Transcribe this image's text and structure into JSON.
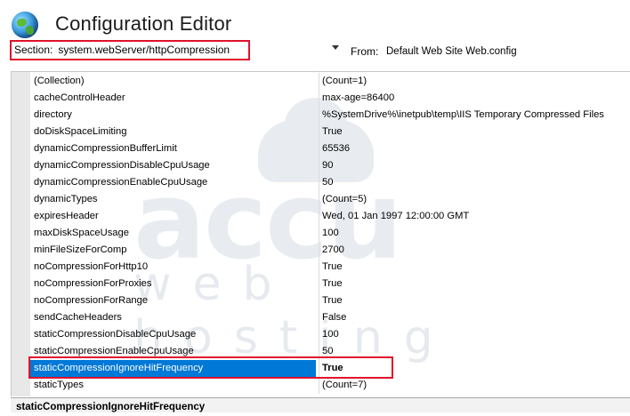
{
  "header": {
    "title": "Configuration Editor",
    "section_label": "Section:",
    "section_value": "system.webServer/httpCompression",
    "from_label": "From:",
    "from_value": "Default Web Site Web.config"
  },
  "watermark": {
    "line1": "accu",
    "line2": "web hosting"
  },
  "properties": [
    {
      "name": "(Collection)",
      "value": "(Count=1)"
    },
    {
      "name": "cacheControlHeader",
      "value": "max-age=86400"
    },
    {
      "name": "directory",
      "value": "%SystemDrive%\\inetpub\\temp\\IIS Temporary Compressed Files"
    },
    {
      "name": "doDiskSpaceLimiting",
      "value": "True"
    },
    {
      "name": "dynamicCompressionBufferLimit",
      "value": "65536"
    },
    {
      "name": "dynamicCompressionDisableCpuUsage",
      "value": "90"
    },
    {
      "name": "dynamicCompressionEnableCpuUsage",
      "value": "50"
    },
    {
      "name": "dynamicTypes",
      "value": "(Count=5)"
    },
    {
      "name": "expiresHeader",
      "value": "Wed, 01 Jan 1997 12:00:00 GMT"
    },
    {
      "name": "maxDiskSpaceUsage",
      "value": "100"
    },
    {
      "name": "minFileSizeForComp",
      "value": "2700"
    },
    {
      "name": "noCompressionForHttp10",
      "value": "True"
    },
    {
      "name": "noCompressionForProxies",
      "value": "True"
    },
    {
      "name": "noCompressionForRange",
      "value": "True"
    },
    {
      "name": "sendCacheHeaders",
      "value": "False"
    },
    {
      "name": "staticCompressionDisableCpuUsage",
      "value": "100"
    },
    {
      "name": "staticCompressionEnableCpuUsage",
      "value": "50"
    },
    {
      "name": "staticCompressionIgnoreHitFrequency",
      "value": "True"
    },
    {
      "name": "staticTypes",
      "value": "(Count=7)"
    }
  ],
  "selected_index": 17,
  "status": {
    "text": "staticCompressionIgnoreHitFrequency"
  },
  "colors": {
    "selection": "#0078d7",
    "highlight_box": "#e0112b"
  }
}
